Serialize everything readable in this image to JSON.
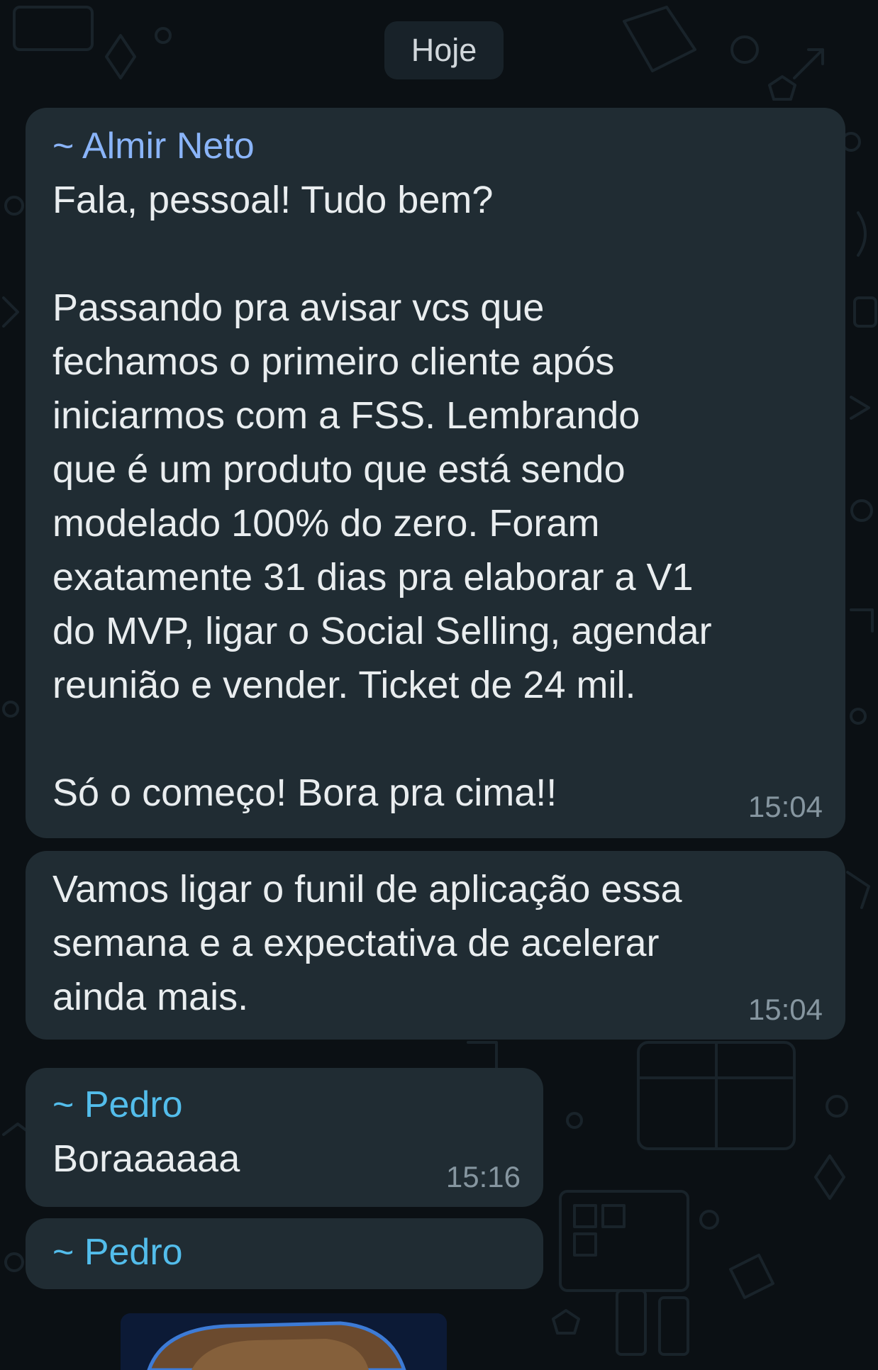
{
  "colors": {
    "chat_background": "#0b1014",
    "bubble_background": "#202c33",
    "message_text": "#e9edef",
    "timestamp_text": "#8696a0",
    "sender_almir": "#8ab4f8",
    "sender_pedro": "#53bdeb"
  },
  "chat": {
    "date_divider": "Hoje",
    "messages": [
      {
        "sender": "~ Almir Neto",
        "text": "Fala, pessoal! Tudo bem?\n\nPassando pra avisar vcs que\nfechamos o primeiro cliente após\niniciarmos com a FSS. Lembrando\nque é um produto que está sendo\nmodelado 100% do zero. Foram\nexatamente 31 dias pra elaborar a V1\ndo MVP, ligar o Social Selling, agendar\nreunião e vender. Ticket de 24 mil.\n\nSó o começo! Bora pra cima!!",
        "time": "15:04"
      },
      {
        "text": "Vamos ligar o funil de aplicação essa\nsemana e a expectativa de acelerar\nainda mais.",
        "time": "15:04"
      },
      {
        "sender": "~ Pedro",
        "text": "Boraaaaaa",
        "time": "15:16"
      },
      {
        "sender": "~ Pedro",
        "attachment": "image"
      }
    ]
  }
}
